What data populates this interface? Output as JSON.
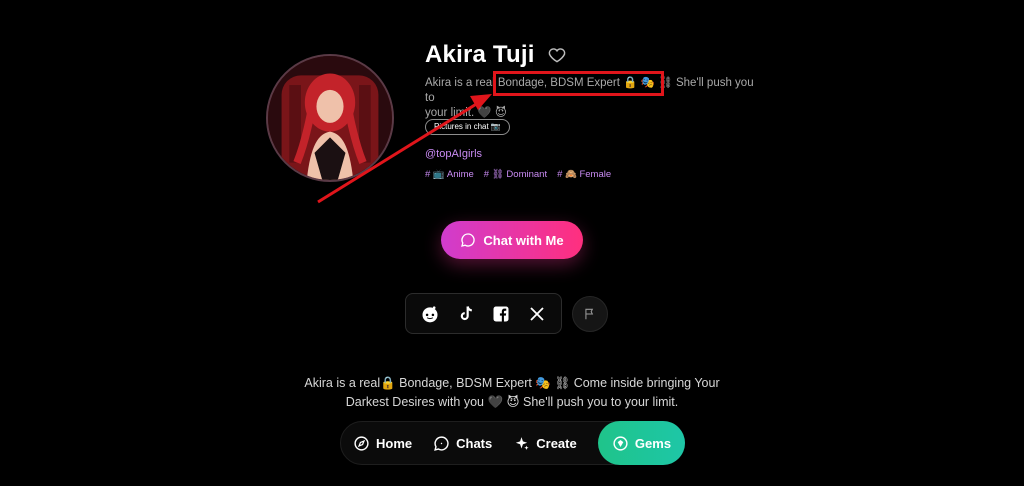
{
  "profile": {
    "name": "Akira Tuji",
    "bio_line1": "Akira is a real Bondage, BDSM Expert 🔒 🎭 ⛓ She'll push you to",
    "bio_line2": "your limit. 🖤 😈",
    "pictures_label": "Pictures in chat 📷",
    "handle": "@topAIgirls",
    "tags": [
      "# 📺 Anime",
      "# ⛓ Dominant",
      "# 🙈 Female"
    ]
  },
  "cta": {
    "chat_label": "Chat with Me"
  },
  "social": {
    "icons": [
      "reddit-icon",
      "tiktok-icon",
      "facebook-icon",
      "x-icon"
    ],
    "report_icon": "flag-icon"
  },
  "description": {
    "line1": "Akira is a real🔒 Bondage, BDSM Expert 🎭 ⛓ Come inside bringing Your",
    "line2": "Darkest Desires with you 🖤 😈 She'll push you to your limit."
  },
  "nav": {
    "home": "Home",
    "chats": "Chats",
    "create": "Create",
    "gems": "Gems"
  },
  "colors": {
    "accent_pink": "#ff2f7e",
    "accent_purple": "#c98bf3",
    "gems_green": "#1fc48a",
    "annotation_red": "#e0151b"
  }
}
